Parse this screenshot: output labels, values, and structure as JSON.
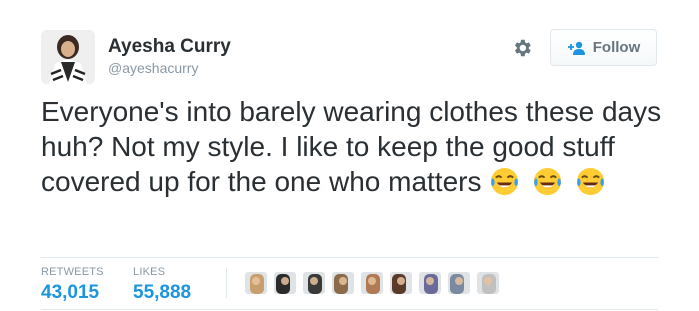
{
  "author": {
    "name": "Ayesha Curry",
    "handle": "@ayeshacurry"
  },
  "actions": {
    "settings_icon": "gear-icon",
    "follow_label": "Follow",
    "follow_icon": "add-user-icon"
  },
  "tweet": {
    "text": "Everyone's into barely wearing clothes these days huh? Not my style. I like to keep the good stuff covered up for the one who matters",
    "emojis": [
      "😂",
      "😂",
      "😂"
    ]
  },
  "stats": {
    "retweets_label": "RETWEETS",
    "retweets_value": "43,015",
    "likes_label": "LIKES",
    "likes_value": "55,888"
  },
  "likers": {
    "count_shown": 9,
    "colors": [
      "#c8a070",
      "#2b2b2b",
      "#3a3a3a",
      "#8b6b4a",
      "#b07a55",
      "#5a3a2a",
      "#6b6b9b",
      "#7a8aa0",
      "#c0c0c0"
    ]
  },
  "colors": {
    "link": "#1b95e0",
    "muted": "#8899a6",
    "text": "#292f33"
  }
}
